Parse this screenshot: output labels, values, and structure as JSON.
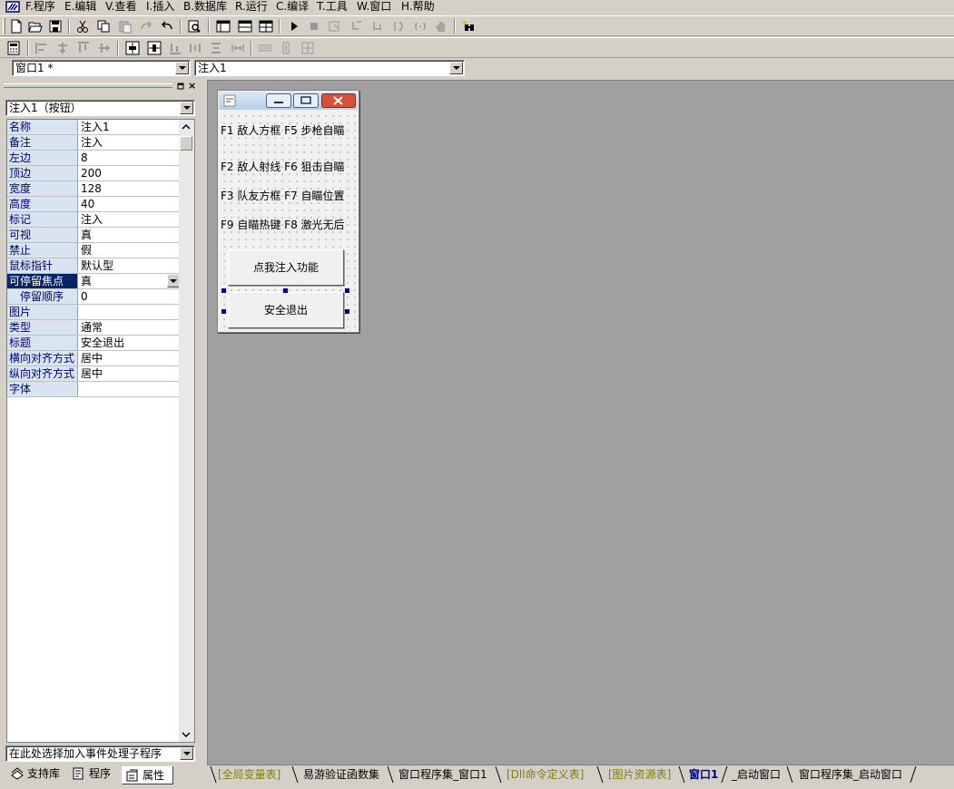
{
  "menu": [
    {
      "label": "F.程序"
    },
    {
      "label": "E.编辑"
    },
    {
      "label": "V.查看"
    },
    {
      "label": "I.插入"
    },
    {
      "label": "B.数据库"
    },
    {
      "label": "R.运行"
    },
    {
      "label": "C.编译"
    },
    {
      "label": "T.工具"
    },
    {
      "label": "W.窗口"
    },
    {
      "label": "H.帮助"
    }
  ],
  "toolbar1_icons": [
    "new-file-icon",
    "open-folder-icon",
    "save-icon",
    "cut-icon",
    "copy-icon",
    "paste-icon",
    "redo-icon",
    "undo-icon",
    "find-icon",
    "layout-window-icon",
    "layout-table-icon",
    "layout-split-icon",
    "run-icon",
    "stop-icon",
    "step-icon",
    "step-into-icon",
    "step-out-icon",
    "step-over-icon",
    "breakpoint-icon",
    "hand-icon",
    "binoculars-icon"
  ],
  "toolbar2_icons": [
    "calculator-icon",
    "align-left-icon",
    "align-hcenter-icon",
    "align-top-icon",
    "align-vcenter-icon",
    "center-horizontal-icon",
    "center-vertical-icon",
    "align-bottom-icon",
    "distribute-h-icon",
    "distribute-v-icon",
    "same-width-icon",
    "same-height-icon",
    "same-size-icon"
  ],
  "selectors": {
    "window_selector": "窗口1 *",
    "component_selector": "注入1"
  },
  "properties_panel": {
    "object_selector": "注入1（按钮）",
    "event_selector": "在此处选择加入事件处理子程序",
    "rows": [
      {
        "name": "名称",
        "value": "注入1"
      },
      {
        "name": "备注",
        "value": "注入"
      },
      {
        "name": "左边",
        "value": "8"
      },
      {
        "name": "顶边",
        "value": "200"
      },
      {
        "name": "宽度",
        "value": "128"
      },
      {
        "name": "高度",
        "value": "40"
      },
      {
        "name": "标记",
        "value": "注入"
      },
      {
        "name": "可视",
        "value": "真"
      },
      {
        "name": "禁止",
        "value": "假"
      },
      {
        "name": "鼠标指针",
        "value": "默认型"
      },
      {
        "name": "可停留焦点",
        "value": "真"
      },
      {
        "name": "停留顺序",
        "value": "0"
      },
      {
        "name": "图片",
        "value": ""
      },
      {
        "name": "类型",
        "value": "通常"
      },
      {
        "name": "标题",
        "value": "安全退出"
      },
      {
        "name": "横向对齐方式",
        "value": "居中"
      },
      {
        "name": "纵向对齐方式",
        "value": "居中"
      },
      {
        "name": "字体",
        "value": ""
      }
    ],
    "tabs": [
      {
        "label": "支持库",
        "icon": "library-icon"
      },
      {
        "label": "程序",
        "icon": "program-icon"
      },
      {
        "label": "属性",
        "icon": "properties-icon"
      }
    ]
  },
  "form_designer": {
    "labels": [
      "F1 敌人方框 F5 步枪自瞄",
      "F2 敌人射线 F6 狙击自瞄",
      "F3 队友方框 F7 自瞄位置",
      "F9 自瞄热键 F8 激光无后"
    ],
    "buttons": [
      {
        "label": "点我注入功能"
      },
      {
        "label": "安全退出"
      }
    ]
  },
  "bottom_tabs": [
    {
      "label": "[全局变量表]",
      "style": "olive"
    },
    {
      "label": "易游验证函数集",
      "style": "normal"
    },
    {
      "label": "窗口程序集_窗口1",
      "style": "normal"
    },
    {
      "label": "[Dll命令定义表]",
      "style": "olive"
    },
    {
      "label": "[图片资源表]",
      "style": "olive"
    },
    {
      "label": "窗口1",
      "style": "active"
    },
    {
      "label": "_启动窗口",
      "style": "normal"
    },
    {
      "label": "窗口程序集_启动窗口",
      "style": "normal"
    }
  ]
}
